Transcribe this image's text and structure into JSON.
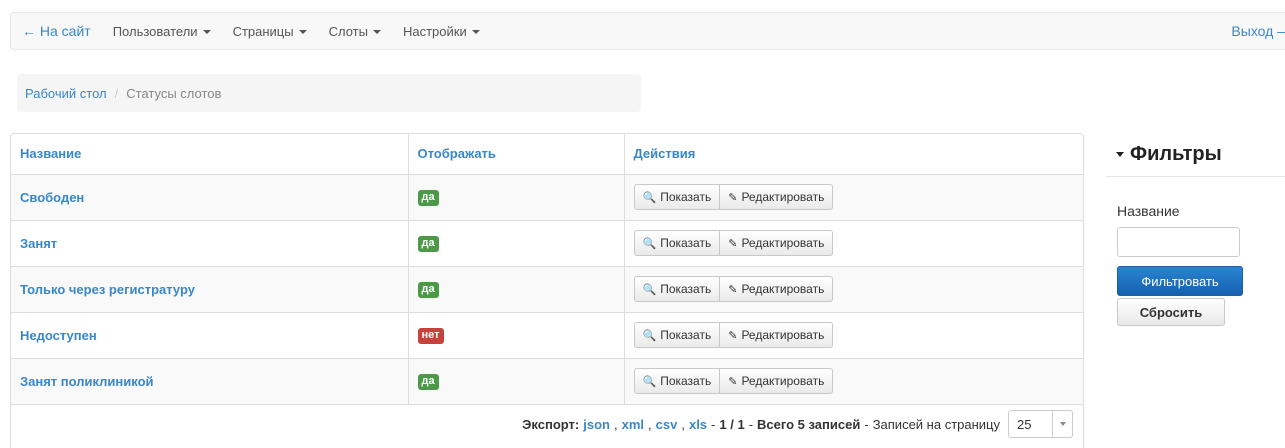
{
  "navbar": {
    "back_label": "← На сайт",
    "menus": [
      {
        "label": "Пользователи"
      },
      {
        "label": "Страницы"
      },
      {
        "label": "Слоты"
      },
      {
        "label": "Настройки"
      }
    ],
    "logout_label": "Выход –"
  },
  "breadcrumb": {
    "home": "Рабочий стол",
    "separator": "/",
    "current": "Статусы слотов"
  },
  "table": {
    "columns": [
      "Название",
      "Отображать",
      "Действия"
    ],
    "rows": [
      {
        "name": "Свободен",
        "display": "да",
        "display_color": "#4c9a47"
      },
      {
        "name": "Занят",
        "display": "да",
        "display_color": "#4c9a47"
      },
      {
        "name": "Только через регистратуру",
        "display": "да",
        "display_color": "#4c9a47"
      },
      {
        "name": "Недоступен",
        "display": "нет",
        "display_color": "#c9413b"
      },
      {
        "name": "Занят поликлиникой",
        "display": "да",
        "display_color": "#4c9a47"
      }
    ],
    "actions": {
      "show": "Показать",
      "edit": "Редактировать"
    }
  },
  "footer": {
    "export_label": "Экспорт:",
    "formats": [
      "json",
      "xml",
      "csv",
      "xls"
    ],
    "page": "1 / 1",
    "total": "Всего 5 записей",
    "per_page_label": "Записей на страницу",
    "per_page_value": "25"
  },
  "filters": {
    "title": "Фильтры",
    "name_label": "Название",
    "name_value": "",
    "filter_button": "Фильтровать",
    "reset_button": "Сбросить"
  }
}
